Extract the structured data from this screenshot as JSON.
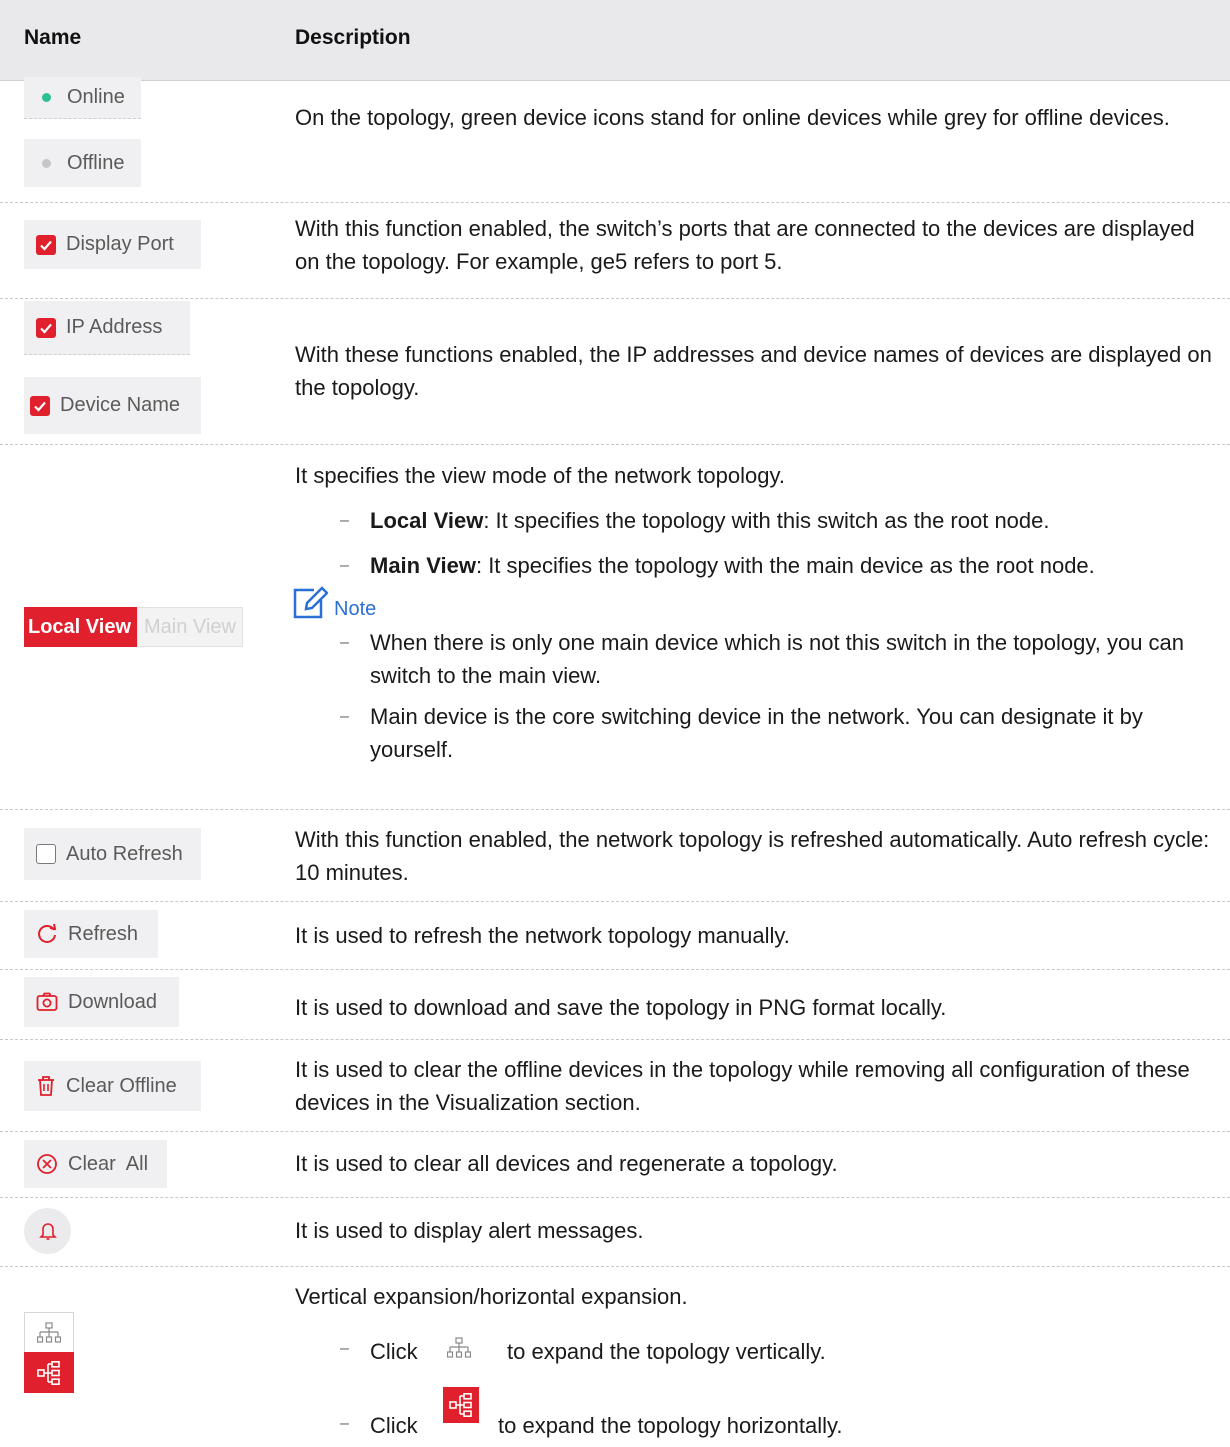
{
  "header": {
    "name": "Name",
    "description": "Description"
  },
  "status": {
    "online_label": "Online",
    "offline_label": "Offline",
    "online_color": "#2ebf91",
    "offline_color": "#c6c6c6",
    "description": "On the topology, green device icons stand for online devices while grey for offline devices."
  },
  "display_port": {
    "label": "Display Port",
    "checked": true,
    "description": "With this function enabled, the switch’s ports that are connected to the devices are displayed on the topology. For example, ge5 refers to port 5."
  },
  "ip_device": {
    "ip_label": "IP Address",
    "device_label": "Device Name",
    "description": "With these functions enabled, the IP addresses and device names of devices are displayed on the topology."
  },
  "view_mode": {
    "local_label": "Local View",
    "main_label": "Main View",
    "intro": "It specifies the view mode of the network topology.",
    "bullets": [
      {
        "term": "Local View",
        "text": ": It specifies the topology with this switch as the root node."
      },
      {
        "term": "Main View",
        "text": ": It specifies the topology with the main device as the root node."
      }
    ],
    "note_title": "Note",
    "notes": [
      "When there is only one main device which is not this switch in the topology, you can switch to the main view.",
      "Main device is the core switching device in the network. You can designate it by yourself."
    ]
  },
  "auto_refresh": {
    "label": "Auto Refresh",
    "checked": false,
    "description": "With this function enabled, the network topology is refreshed automatically. Auto refresh cycle: 10 minutes."
  },
  "refresh": {
    "label": "Refresh",
    "icon": "refresh-icon",
    "description": "It is used to refresh the network topology manually."
  },
  "download": {
    "label": "Download",
    "icon": "camera-icon",
    "description": "It is used to download and save the topology in PNG format locally."
  },
  "clear_offline": {
    "label": "Clear Offline",
    "icon": "trash-icon",
    "description": "It is used to clear the offline devices in the topology while removing all configuration of these devices in the Visualization section."
  },
  "clear_all": {
    "label": "Clear  All",
    "icon": "close-circle-icon",
    "description": "It is used to clear all devices and regenerate a topology."
  },
  "alert": {
    "icon": "bell-icon",
    "description": "It is used to display alert messages."
  },
  "expansion": {
    "intro": "Vertical expansion/horizontal expansion.",
    "click_word": "Click",
    "vertical_text": "to expand the topology vertically.",
    "horizontal_text": "to expand the topology horizontally."
  },
  "colors": {
    "accent": "#e0202c",
    "note": "#2a6fd6"
  }
}
